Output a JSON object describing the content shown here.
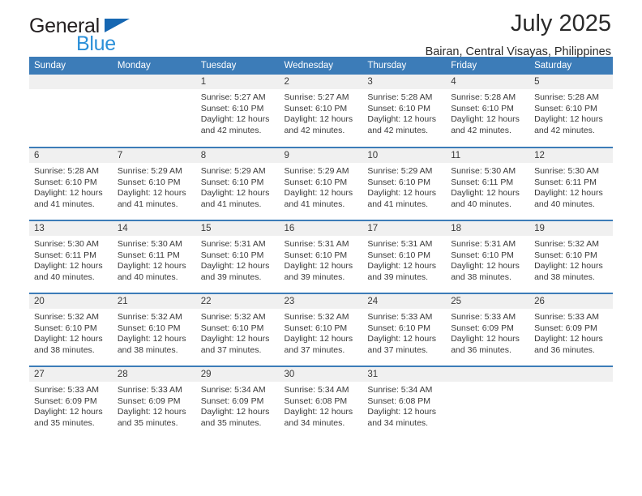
{
  "brand": {
    "name_top": "General",
    "name_bottom": "Blue",
    "triangle_color": "#1667b2",
    "blue_color": "#2a8fd8"
  },
  "header": {
    "title": "July 2025",
    "location": "Bairan, Central Visayas, Philippines"
  },
  "theme": {
    "header_bg": "#3c7cb8",
    "daynum_bg": "#f0f0f0",
    "row_divider": "#3c7cb8",
    "text": "#3a3a3a"
  },
  "calendar": {
    "weekday_headers": [
      "Sunday",
      "Monday",
      "Tuesday",
      "Wednesday",
      "Thursday",
      "Friday",
      "Saturday"
    ],
    "weeks": [
      [
        {
          "day": "",
          "sunrise": "",
          "sunset": "",
          "daylight_line1": "",
          "daylight_line2": "",
          "blank": true
        },
        {
          "day": "",
          "sunrise": "",
          "sunset": "",
          "daylight_line1": "",
          "daylight_line2": "",
          "blank": true
        },
        {
          "day": "1",
          "sunrise": "Sunrise: 5:27 AM",
          "sunset": "Sunset: 6:10 PM",
          "daylight_line1": "Daylight: 12 hours",
          "daylight_line2": "and 42 minutes."
        },
        {
          "day": "2",
          "sunrise": "Sunrise: 5:27 AM",
          "sunset": "Sunset: 6:10 PM",
          "daylight_line1": "Daylight: 12 hours",
          "daylight_line2": "and 42 minutes."
        },
        {
          "day": "3",
          "sunrise": "Sunrise: 5:28 AM",
          "sunset": "Sunset: 6:10 PM",
          "daylight_line1": "Daylight: 12 hours",
          "daylight_line2": "and 42 minutes."
        },
        {
          "day": "4",
          "sunrise": "Sunrise: 5:28 AM",
          "sunset": "Sunset: 6:10 PM",
          "daylight_line1": "Daylight: 12 hours",
          "daylight_line2": "and 42 minutes."
        },
        {
          "day": "5",
          "sunrise": "Sunrise: 5:28 AM",
          "sunset": "Sunset: 6:10 PM",
          "daylight_line1": "Daylight: 12 hours",
          "daylight_line2": "and 42 minutes."
        }
      ],
      [
        {
          "day": "6",
          "sunrise": "Sunrise: 5:28 AM",
          "sunset": "Sunset: 6:10 PM",
          "daylight_line1": "Daylight: 12 hours",
          "daylight_line2": "and 41 minutes."
        },
        {
          "day": "7",
          "sunrise": "Sunrise: 5:29 AM",
          "sunset": "Sunset: 6:10 PM",
          "daylight_line1": "Daylight: 12 hours",
          "daylight_line2": "and 41 minutes."
        },
        {
          "day": "8",
          "sunrise": "Sunrise: 5:29 AM",
          "sunset": "Sunset: 6:10 PM",
          "daylight_line1": "Daylight: 12 hours",
          "daylight_line2": "and 41 minutes."
        },
        {
          "day": "9",
          "sunrise": "Sunrise: 5:29 AM",
          "sunset": "Sunset: 6:10 PM",
          "daylight_line1": "Daylight: 12 hours",
          "daylight_line2": "and 41 minutes."
        },
        {
          "day": "10",
          "sunrise": "Sunrise: 5:29 AM",
          "sunset": "Sunset: 6:10 PM",
          "daylight_line1": "Daylight: 12 hours",
          "daylight_line2": "and 41 minutes."
        },
        {
          "day": "11",
          "sunrise": "Sunrise: 5:30 AM",
          "sunset": "Sunset: 6:11 PM",
          "daylight_line1": "Daylight: 12 hours",
          "daylight_line2": "and 40 minutes."
        },
        {
          "day": "12",
          "sunrise": "Sunrise: 5:30 AM",
          "sunset": "Sunset: 6:11 PM",
          "daylight_line1": "Daylight: 12 hours",
          "daylight_line2": "and 40 minutes."
        }
      ],
      [
        {
          "day": "13",
          "sunrise": "Sunrise: 5:30 AM",
          "sunset": "Sunset: 6:11 PM",
          "daylight_line1": "Daylight: 12 hours",
          "daylight_line2": "and 40 minutes."
        },
        {
          "day": "14",
          "sunrise": "Sunrise: 5:30 AM",
          "sunset": "Sunset: 6:11 PM",
          "daylight_line1": "Daylight: 12 hours",
          "daylight_line2": "and 40 minutes."
        },
        {
          "day": "15",
          "sunrise": "Sunrise: 5:31 AM",
          "sunset": "Sunset: 6:10 PM",
          "daylight_line1": "Daylight: 12 hours",
          "daylight_line2": "and 39 minutes."
        },
        {
          "day": "16",
          "sunrise": "Sunrise: 5:31 AM",
          "sunset": "Sunset: 6:10 PM",
          "daylight_line1": "Daylight: 12 hours",
          "daylight_line2": "and 39 minutes."
        },
        {
          "day": "17",
          "sunrise": "Sunrise: 5:31 AM",
          "sunset": "Sunset: 6:10 PM",
          "daylight_line1": "Daylight: 12 hours",
          "daylight_line2": "and 39 minutes."
        },
        {
          "day": "18",
          "sunrise": "Sunrise: 5:31 AM",
          "sunset": "Sunset: 6:10 PM",
          "daylight_line1": "Daylight: 12 hours",
          "daylight_line2": "and 38 minutes."
        },
        {
          "day": "19",
          "sunrise": "Sunrise: 5:32 AM",
          "sunset": "Sunset: 6:10 PM",
          "daylight_line1": "Daylight: 12 hours",
          "daylight_line2": "and 38 minutes."
        }
      ],
      [
        {
          "day": "20",
          "sunrise": "Sunrise: 5:32 AM",
          "sunset": "Sunset: 6:10 PM",
          "daylight_line1": "Daylight: 12 hours",
          "daylight_line2": "and 38 minutes."
        },
        {
          "day": "21",
          "sunrise": "Sunrise: 5:32 AM",
          "sunset": "Sunset: 6:10 PM",
          "daylight_line1": "Daylight: 12 hours",
          "daylight_line2": "and 38 minutes."
        },
        {
          "day": "22",
          "sunrise": "Sunrise: 5:32 AM",
          "sunset": "Sunset: 6:10 PM",
          "daylight_line1": "Daylight: 12 hours",
          "daylight_line2": "and 37 minutes."
        },
        {
          "day": "23",
          "sunrise": "Sunrise: 5:32 AM",
          "sunset": "Sunset: 6:10 PM",
          "daylight_line1": "Daylight: 12 hours",
          "daylight_line2": "and 37 minutes."
        },
        {
          "day": "24",
          "sunrise": "Sunrise: 5:33 AM",
          "sunset": "Sunset: 6:10 PM",
          "daylight_line1": "Daylight: 12 hours",
          "daylight_line2": "and 37 minutes."
        },
        {
          "day": "25",
          "sunrise": "Sunrise: 5:33 AM",
          "sunset": "Sunset: 6:09 PM",
          "daylight_line1": "Daylight: 12 hours",
          "daylight_line2": "and 36 minutes."
        },
        {
          "day": "26",
          "sunrise": "Sunrise: 5:33 AM",
          "sunset": "Sunset: 6:09 PM",
          "daylight_line1": "Daylight: 12 hours",
          "daylight_line2": "and 36 minutes."
        }
      ],
      [
        {
          "day": "27",
          "sunrise": "Sunrise: 5:33 AM",
          "sunset": "Sunset: 6:09 PM",
          "daylight_line1": "Daylight: 12 hours",
          "daylight_line2": "and 35 minutes."
        },
        {
          "day": "28",
          "sunrise": "Sunrise: 5:33 AM",
          "sunset": "Sunset: 6:09 PM",
          "daylight_line1": "Daylight: 12 hours",
          "daylight_line2": "and 35 minutes."
        },
        {
          "day": "29",
          "sunrise": "Sunrise: 5:34 AM",
          "sunset": "Sunset: 6:09 PM",
          "daylight_line1": "Daylight: 12 hours",
          "daylight_line2": "and 35 minutes."
        },
        {
          "day": "30",
          "sunrise": "Sunrise: 5:34 AM",
          "sunset": "Sunset: 6:08 PM",
          "daylight_line1": "Daylight: 12 hours",
          "daylight_line2": "and 34 minutes."
        },
        {
          "day": "31",
          "sunrise": "Sunrise: 5:34 AM",
          "sunset": "Sunset: 6:08 PM",
          "daylight_line1": "Daylight: 12 hours",
          "daylight_line2": "and 34 minutes."
        },
        {
          "day": "",
          "sunrise": "",
          "sunset": "",
          "daylight_line1": "",
          "daylight_line2": "",
          "blank": true
        },
        {
          "day": "",
          "sunrise": "",
          "sunset": "",
          "daylight_line1": "",
          "daylight_line2": "",
          "blank": true
        }
      ]
    ]
  }
}
